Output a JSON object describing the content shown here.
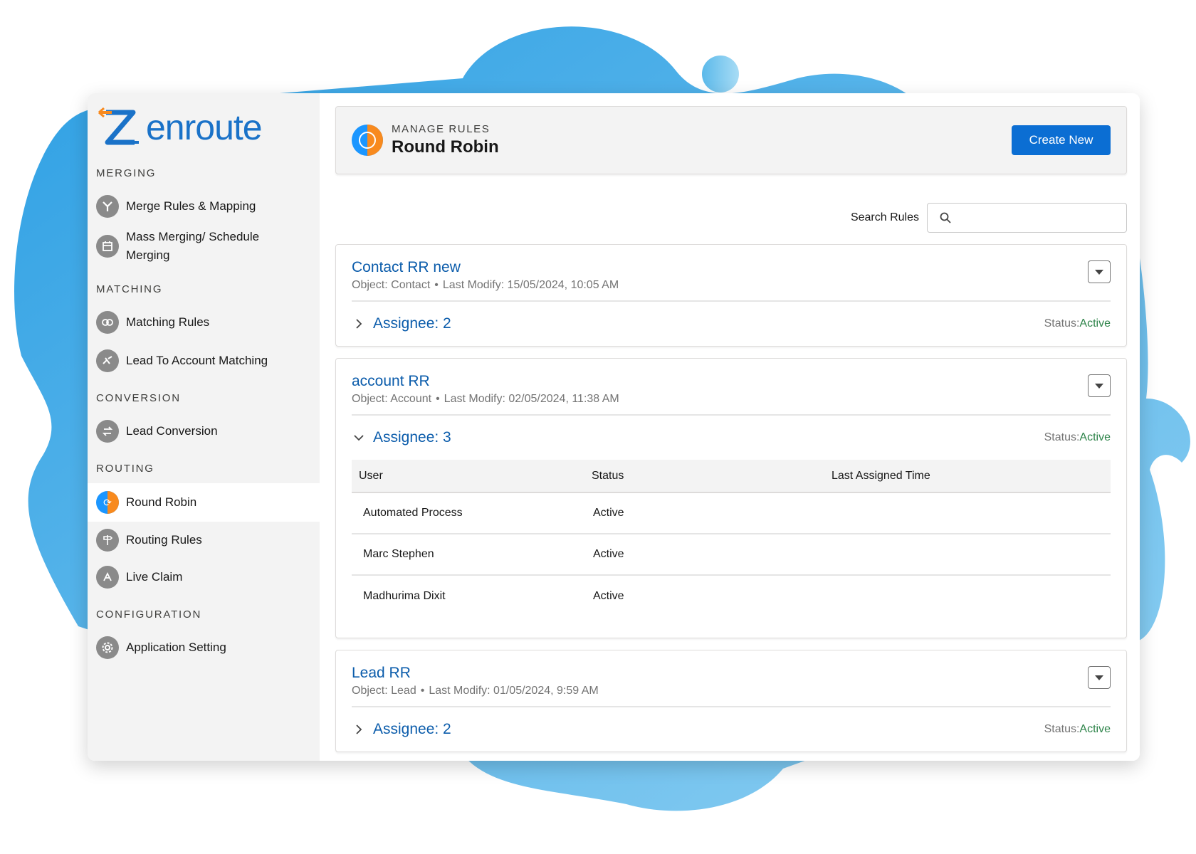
{
  "brand": {
    "name": "enroute",
    "initial": "Z",
    "accent": "#1a72c8",
    "arrow_color": "#f88a1e"
  },
  "sidebar": {
    "sections": [
      {
        "title": "MERGING",
        "items": [
          {
            "label": "Merge Rules & Mapping",
            "icon": "merge-icon"
          },
          {
            "label": "Mass Merging/ Schedule Merging",
            "icon": "calendar-icon"
          }
        ]
      },
      {
        "title": "MATCHING",
        "items": [
          {
            "label": "Matching Rules",
            "icon": "matching-icon"
          },
          {
            "label": "Lead To Account Matching",
            "icon": "link-icon"
          }
        ]
      },
      {
        "title": "CONVERSION",
        "items": [
          {
            "label": "Lead Conversion",
            "icon": "convert-icon"
          }
        ]
      },
      {
        "title": "ROUTING",
        "items": [
          {
            "label": "Round Robin",
            "icon": "round-robin-icon",
            "active": true
          },
          {
            "label": "Routing Rules",
            "icon": "signpost-icon"
          },
          {
            "label": "Live Claim",
            "icon": "claim-icon"
          }
        ]
      },
      {
        "title": "CONFIGURATION",
        "items": [
          {
            "label": "Application Setting",
            "icon": "gear-icon"
          }
        ]
      }
    ]
  },
  "header": {
    "subtitle": "MANAGE RULES",
    "title": "Round Robin",
    "create_label": "Create New"
  },
  "search": {
    "label": "Search Rules",
    "placeholder": ""
  },
  "rules": [
    {
      "name": "Contact RR new",
      "object": "Object: Contact",
      "modified": "Last Modify: 15/05/2024, 10:05 AM",
      "assignee": "Assignee: 2",
      "status_label": "Status:",
      "status_value": "Active",
      "expanded": false
    },
    {
      "name": "account RR",
      "object": "Object: Account",
      "modified": "Last Modify: 02/05/2024, 11:38 AM",
      "assignee": "Assignee: 3",
      "status_label": "Status:",
      "status_value": "Active",
      "expanded": true,
      "columns": [
        "User",
        "Status",
        "Last Assigned Time"
      ],
      "users": [
        {
          "user": "Automated Process",
          "status": "Active",
          "last": ""
        },
        {
          "user": "Marc Stephen",
          "status": "Active",
          "last": ""
        },
        {
          "user": "Madhurima Dixit",
          "status": "Active",
          "last": ""
        }
      ]
    },
    {
      "name": "Lead RR",
      "object": "Object: Lead",
      "modified": "Last Modify: 01/05/2024, 9:59 AM",
      "assignee": "Assignee: 2",
      "status_label": "Status:",
      "status_value": "Active",
      "expanded": false
    }
  ],
  "colors": {
    "link": "#0b5cab",
    "active_status": "#2e844a",
    "primary_button": "#0b6ed3",
    "blob": "#3aa6e6"
  }
}
